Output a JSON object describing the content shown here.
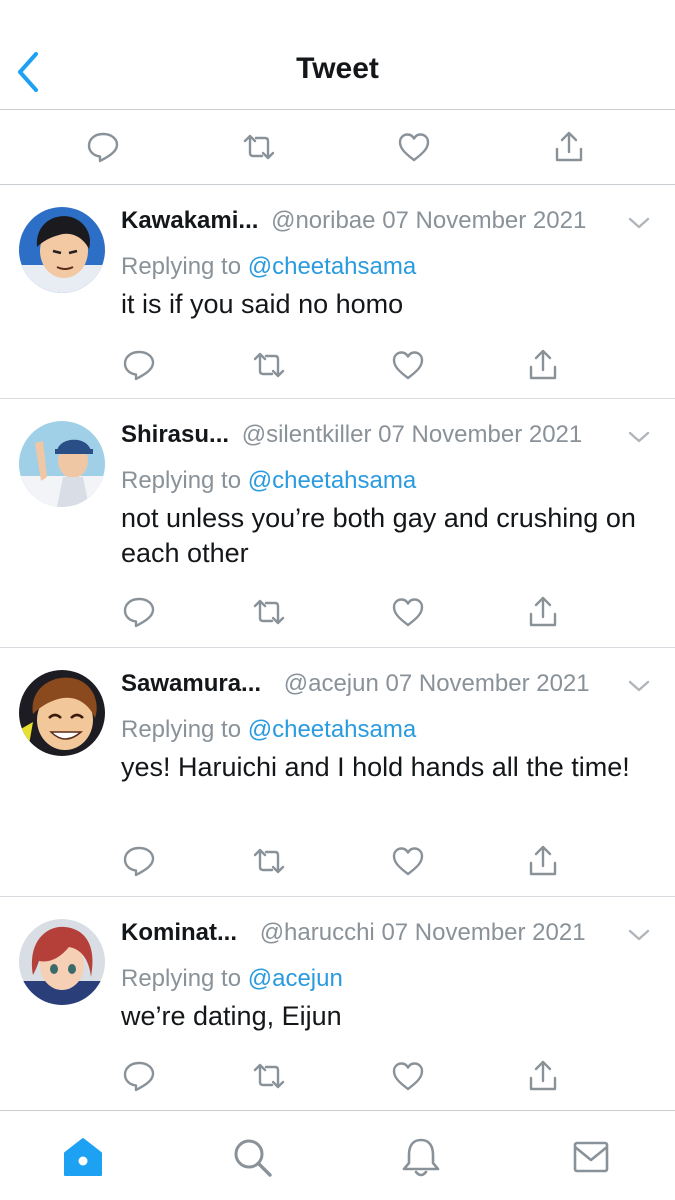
{
  "header": {
    "title": "Tweet"
  },
  "colors": {
    "accent": "#1da1f2",
    "mention": "#2a9bdf",
    "meta": "#8a9299",
    "icon": "#8a9299",
    "divider": "#c8cdd1"
  },
  "top_actions": [
    "reply-icon",
    "retweet-icon",
    "like-icon",
    "share-icon"
  ],
  "tweets": [
    {
      "name": "Kawakami...",
      "handle": "@noribae",
      "date": "07 November 2021",
      "reply_prefix": "Replying to",
      "reply_to": "@cheetahsama",
      "text": "it is if you said no homo"
    },
    {
      "name": "Shirasu...",
      "handle": "@silentkiller",
      "date": "07 November 2021",
      "reply_prefix": "Replying to",
      "reply_to": "@cheetahsama",
      "text": "not unless you’re both gay and crushing on each other"
    },
    {
      "name": "Sawamura...",
      "handle": "@acejun",
      "date": "07 November 2021",
      "reply_prefix": "Replying to",
      "reply_to": "@cheetahsama",
      "text": "yes! Haruichi and I hold hands all the time!"
    },
    {
      "name": "Kominat...",
      "handle": "@harucchi",
      "date": "07 November 2021",
      "reply_prefix": "Replying to",
      "reply_to": "@acejun",
      "text": "we’re dating, Eijun"
    }
  ],
  "tabbar": {
    "items": [
      "home-icon",
      "search-icon",
      "notifications-icon",
      "messages-icon"
    ],
    "active": "home-icon"
  }
}
